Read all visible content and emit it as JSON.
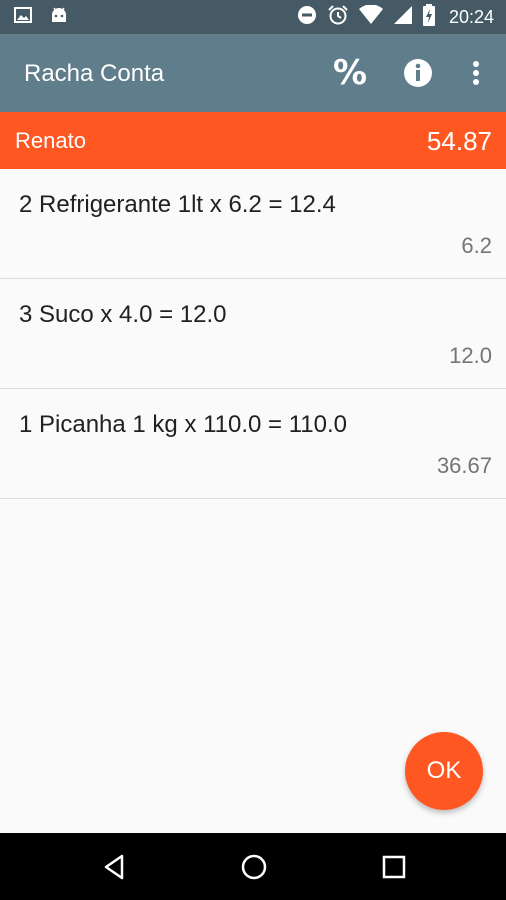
{
  "status_bar": {
    "time": "20:24",
    "icons": [
      "image-icon",
      "android-icon",
      "do-not-disturb-icon",
      "alarm-icon",
      "wifi-icon",
      "signal-icon",
      "battery-charging-icon"
    ]
  },
  "app_bar": {
    "title": "Racha Conta",
    "actions": [
      "percent-icon",
      "info-icon",
      "more-vert-icon"
    ],
    "percent_label": "%"
  },
  "person": {
    "name": "Renato",
    "total": "54.87",
    "color": "#ff5722"
  },
  "items": [
    {
      "description": "2 Refrigerante 1lt x 6.2 = 12.4",
      "share": "6.2"
    },
    {
      "description": "3 Suco x 4.0 = 12.0",
      "share": "12.0"
    },
    {
      "description": "1 Picanha 1 kg x 110.0 = 110.0",
      "share": "36.67"
    }
  ],
  "fab": {
    "label": "OK"
  },
  "colors": {
    "status_bar": "#455a64",
    "app_bar": "#607d8b",
    "accent": "#ff5722"
  }
}
